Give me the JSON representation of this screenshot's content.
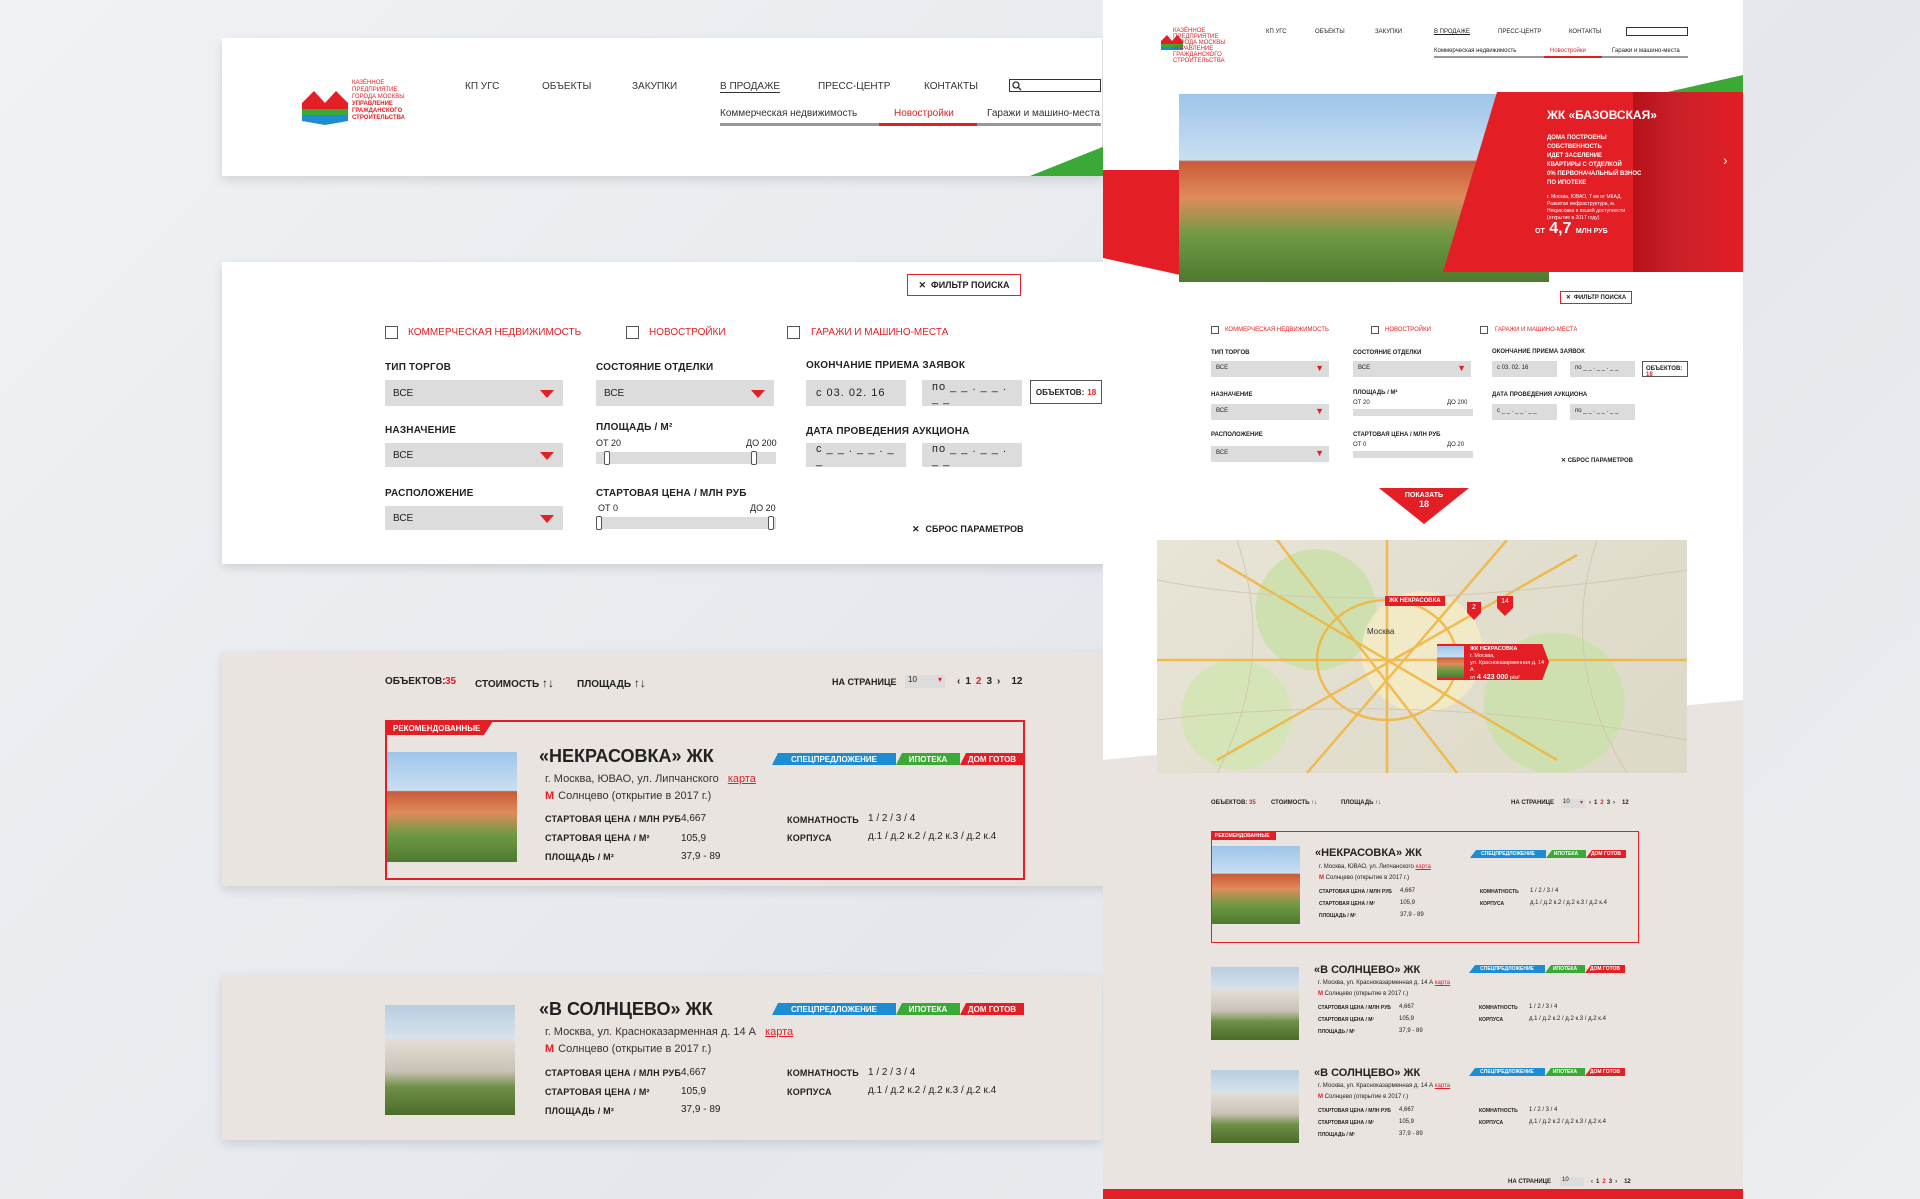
{
  "logo": {
    "lines": [
      "КАЗЁННОЕ",
      "ПРЕДПРИЯТИЕ",
      "ГОРОДА МОСКВЫ",
      "УПРАВЛЕНИЕ",
      "ГРАЖДАНСКОГО",
      "СТРОИТЕЛЬСТВА"
    ]
  },
  "nav": {
    "items": [
      "КП УГС",
      "ОБЪЕКТЫ",
      "ЗАКУПКИ",
      "В ПРОДАЖЕ",
      "ПРЕСС-ЦЕНТР",
      "КОНТАКТЫ"
    ],
    "sub": [
      "Коммерческая недвижимость",
      "Новостройки",
      "Гаражи и машино-места"
    ]
  },
  "filter": {
    "toggle": "ФИЛЬТР ПОИСКА",
    "checks": [
      "КОММЕРЧЕСКАЯ НЕДВИЖИМОСТЬ",
      "НОВОСТРОЙКИ",
      "ГАРАЖИ И МАШИНО-МЕСТА"
    ],
    "trade_type": "ТИП ТОРГОВ",
    "finish": "СОСТОЯНИЕ ОТДЕЛКИ",
    "deadline": "ОКОНЧАНИЕ ПРИЕМА ЗАЯВОК",
    "purpose": "НАЗНАЧЕНИЕ",
    "area": "ПЛОЩАДЬ / М²",
    "auction_date": "ДАТА ПРОВЕДЕНИЯ АУКЦИОНА",
    "location": "РАСПОЛОЖЕНИЕ",
    "price": "СТАРТОВАЯ ЦЕНА / МЛН РУБ",
    "all": "ВСЕ",
    "from_date": "с   03. 02. 16",
    "to_date": "по _ _ . _ _ . _ _",
    "from_blank": "с  _ _ . _ _ . _ _",
    "to_blank": "по _ _ . _ _ . _ _",
    "area_from": "ОТ 20",
    "area_to": "ДО 200",
    "price_from": "ОТ  0",
    "price_to": "ДО  20",
    "objects_label": "ОБЪЕКТОВ:",
    "objects_count": "18",
    "reset": "СБРОС ПАРАМЕТРОВ",
    "show": "ПОКАЗАТЬ",
    "show_count": "18"
  },
  "toolbar": {
    "objects_label": "ОБЪЕКТОВ:",
    "objects_count": "35",
    "cost": "СТОИМОСТЬ",
    "area": "ПЛОЩАДЬ",
    "per_page": "НА СТРАНИЦЕ",
    "per_page_val": "10",
    "pages": [
      "1",
      "2",
      "3"
    ],
    "last": "12"
  },
  "tags": [
    "СПЕЦПРЕДЛОЖЕНИЕ",
    "ИПОТЕКА",
    "ДОМ ГОТОВ"
  ],
  "recommended": "РЕКОМЕНДОВАННЫЕ",
  "listings": [
    {
      "title": "«НЕКРАСОВКА» ЖК",
      "address": "г. Москва, ЮВАО, ул. Липчанского",
      "map": "карта",
      "metro": "Солнцево (открытие в 2017 г.)",
      "price_label": "СТАРТОВАЯ ЦЕНА / МЛН РУБ",
      "price": "4,667",
      "sqm_label": "СТАРТОВАЯ ЦЕНА / М²",
      "sqm": "105,9",
      "area_label": "ПЛОЩАДЬ / М²",
      "area": "37,9 - 89",
      "rooms_label": "КОМНАТНОСТЬ",
      "rooms": "1 / 2 / 3 / 4",
      "blocks_label": "КОРПУСА",
      "blocks": "д.1 / д.2 к.2 / д.2 к.3 / д.2 к.4"
    },
    {
      "title": "«В СОЛНЦЕВО» ЖК",
      "address": "г. Москва, ул. Красноказарменная д. 14 А",
      "map": "карта",
      "metro": "Солнцево (открытие в 2017 г.)",
      "price_label": "СТАРТОВАЯ ЦЕНА / МЛН РУБ",
      "price": "4,667",
      "sqm_label": "СТАРТОВАЯ ЦЕНА / М²",
      "sqm": "105,9",
      "area_label": "ПЛОЩАДЬ / М²",
      "area": "37,9 - 89",
      "rooms_label": "КОМНАТНОСТЬ",
      "rooms": "1 / 2 / 3 / 4",
      "blocks_label": "КОРПУСА",
      "blocks": "д.1 / д.2 к.2 / д.2 к.3 / д.2 к.4"
    }
  ],
  "metro_letter": "М",
  "hero": {
    "title": "ЖК «БАЗОВСКАЯ»",
    "bullets": [
      "ДОМА ПОСТРОЕНЫ",
      "СОБСТВЕННОСТЬ",
      "ИДЕТ ЗАСЕЛЕНИЕ",
      "КВАРТИРЫ С ОТДЕЛКОЙ",
      "0% ПЕРВОНАЧАЛЬНЫЙ ВЗНОС",
      "ПО ИПОТЕКЕ"
    ],
    "desc": "г. Москва, ЮВАО, 7 км от МКАД. Развитая инфраструктура, м. Некрасовка в пешей доступности (открытие в 2017 году)",
    "price_from": "ОТ",
    "price": "4,7",
    "price_unit": "МЛН РУБ"
  },
  "map": {
    "marker1": "ЖК НЕКРАСОВКА",
    "city": "Москва",
    "pin1": "2",
    "pin2": "14",
    "popup_title": "ЖК НЕКРАСОВКА",
    "popup_city": "г. Москва,",
    "popup_addr": "ул. Красноказарменная д. 14 А",
    "popup_from": "от",
    "popup_price": "4 423 000",
    "popup_unit": "р/м²"
  },
  "colors": {
    "accent": "#e31e24",
    "green": "#3aa935",
    "blue": "#1d8cd3",
    "beige": "#e9e4df"
  }
}
